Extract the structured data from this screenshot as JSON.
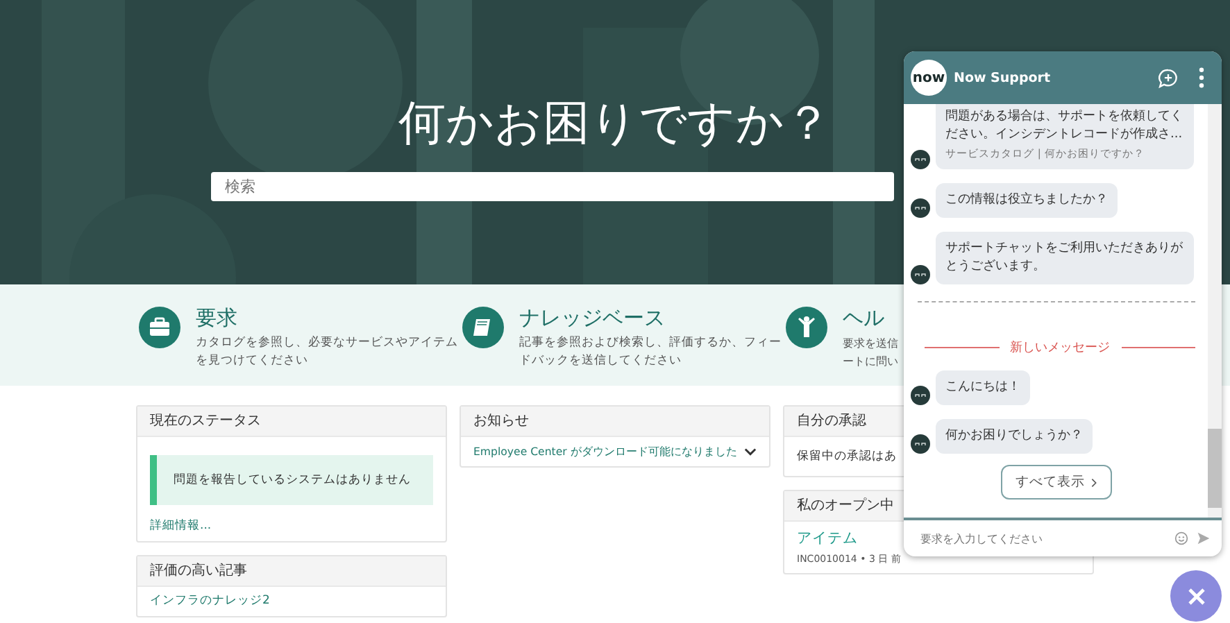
{
  "hero": {
    "title": "何かお困りですか？",
    "search": {
      "placeholder": "検索"
    }
  },
  "categories": [
    {
      "title": "要求",
      "description": "カタログを参照し、必要なサービスやアイテムを見つけてください"
    },
    {
      "title": "ナレッジベース",
      "description": "記事を参照および検索し、評価するか、フィードバックを送信してください"
    },
    {
      "title": "ヘル",
      "description": "要求を送信ートに問い"
    }
  ],
  "columns": [
    [
      {
        "title": "現在のステータス",
        "items": [
          {
            "kind": "alert",
            "text": "問題を報告しているシステムはありません"
          },
          {
            "kind": "link",
            "text": "詳細情報..."
          }
        ]
      },
      {
        "title": "評価の高い記事",
        "items": [
          {
            "kind": "link",
            "text": "インフラのナレッジ2"
          }
        ]
      }
    ],
    [
      {
        "title": "お知らせ",
        "items": [
          {
            "kind": "expandable",
            "text": "Employee Center がダウンロード可能になりました",
            "expanded": false
          }
        ]
      }
    ],
    [
      {
        "title": "自分の承認",
        "items": [
          {
            "kind": "text",
            "text": "保留中の承認はあ"
          }
        ]
      },
      {
        "title": "私のオープン中",
        "items": [
          {
            "kind": "record",
            "text": "アイテム",
            "meta": "INC0010014 • 3 日 前"
          }
        ]
      }
    ]
  ],
  "chat": {
    "logo": "now",
    "title": "Now Support",
    "messages": [
      {
        "kind": "bot",
        "text": "問題がある場合は、サポートを依頼してください。インシデントレコードが作成さ...",
        "link": "サービスカタログ | 何かお困りですか？"
      },
      {
        "kind": "bot",
        "text": "この情報は役立ちましたか？"
      },
      {
        "kind": "bot",
        "text": "サポートチャットをご利用いただきありがとうございます。"
      },
      {
        "kind": "separator"
      },
      {
        "kind": "new_divider",
        "text": "新しいメッセージ"
      },
      {
        "kind": "bot",
        "text": "こんにちは！"
      },
      {
        "kind": "bot",
        "text": "何かお困りでしょうか？"
      },
      {
        "kind": "action",
        "text": "すべて表示"
      }
    ],
    "input": {
      "placeholder": "要求を入力してください"
    }
  }
}
